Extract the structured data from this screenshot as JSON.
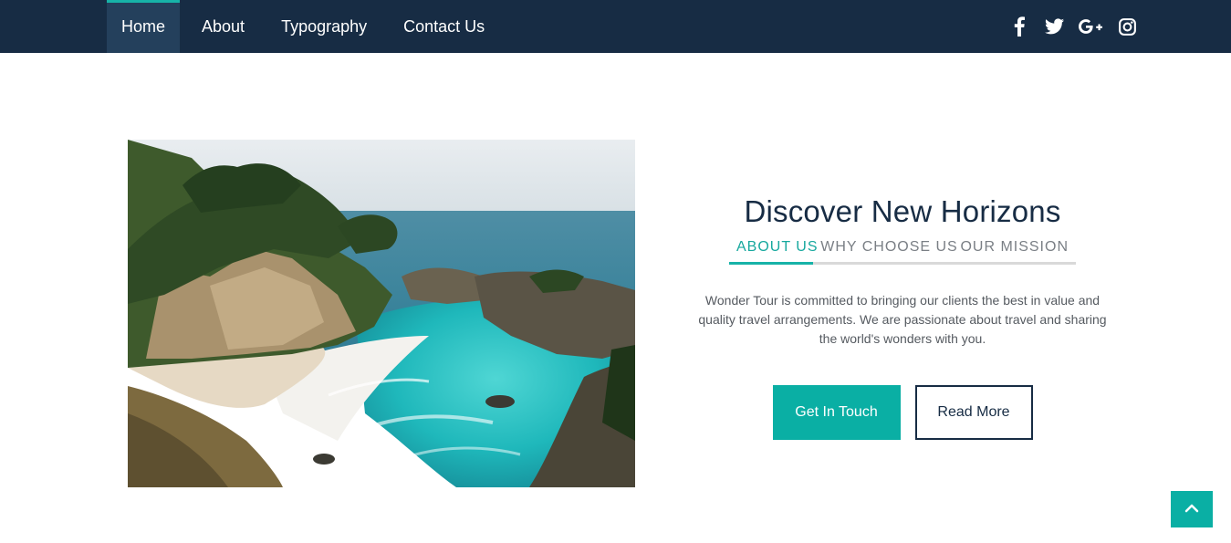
{
  "nav": {
    "items": [
      {
        "label": "Home",
        "active": true
      },
      {
        "label": "About",
        "active": false
      },
      {
        "label": "Typography",
        "active": false
      },
      {
        "label": "Contact Us",
        "active": false
      }
    ]
  },
  "social": {
    "icons": [
      "facebook-icon",
      "twitter-icon",
      "google-plus-icon",
      "instagram-icon"
    ]
  },
  "hero": {
    "image_alt": "Coastal cove with turquoise water and waterfall",
    "title": "Discover New Horizons",
    "tabs": [
      {
        "label": "ABOUT US",
        "active": true
      },
      {
        "label": "WHY CHOOSE US",
        "active": false
      },
      {
        "label": "OUR MISSION",
        "active": false
      }
    ],
    "description": "Wonder Tour is committed to bringing our clients the best in value and quality travel arrangements. We are passionate about travel and sharing the world's wonders with you.",
    "buttons": {
      "primary": "Get In Touch",
      "secondary": "Read More"
    }
  },
  "colors": {
    "navbar": "#172c44",
    "nav_active": "#24405c",
    "accent": "#0aafa4",
    "title": "#172c44"
  },
  "back_to_top_icon": "chevron-up-icon"
}
